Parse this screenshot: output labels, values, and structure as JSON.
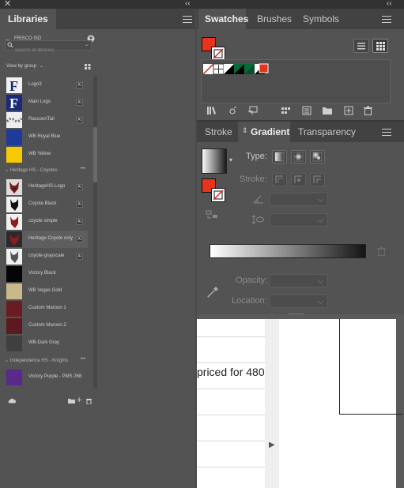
{
  "libraries": {
    "tab_label": "Libraries",
    "library_name": "FRISCO ISD",
    "search_placeholder": "Search all libraries",
    "view_by": "View by group",
    "items_top": [
      {
        "label": "Logo3",
        "badge": "Ai",
        "icon": "f-logo-icon"
      },
      {
        "label": "Main Logo",
        "badge": "Ai",
        "icon": "f-logo-icon"
      },
      {
        "label": "RaccoonTail",
        "badge": "Ai",
        "icon": "raccoon-tail-icon"
      },
      {
        "label": "WB Royal Blue",
        "color": "#1e3a9a"
      },
      {
        "label": "WB Yellow",
        "color": "#f7c900"
      }
    ],
    "group_heritage": "Heritage HS - Coyotes",
    "items_heritage": [
      {
        "label": "HeritageHS-Logo",
        "badge": "Ai",
        "icon": "coyote-logo-icon"
      },
      {
        "label": "Coyote Black",
        "badge": "Ai",
        "icon": "coyote-black-icon"
      },
      {
        "label": "coyote simple",
        "badge": "Ai",
        "icon": "coyote-simple-icon"
      },
      {
        "label": "Heritage Coyote only",
        "badge": "Ai",
        "icon": "coyote-only-icon"
      },
      {
        "label": "coyote-grayscale",
        "badge": "Ai",
        "icon": "coyote-grayscale-icon"
      },
      {
        "label": "Victory Black",
        "color": "#050505"
      },
      {
        "label": "WB Vegas Gold",
        "color": "#c9b88a"
      },
      {
        "label": "Custom Maroon 1",
        "color": "#6b1b22"
      },
      {
        "label": "Custom Maroon 2",
        "color": "#5c1a20"
      },
      {
        "label": "WB-Dark Gray",
        "color": "#3f3f3f"
      }
    ],
    "group_independence": "Independence HS - Knights",
    "items_independence": [
      {
        "label": "Victory Purple - PMS 268",
        "color": "#5a2a8a"
      }
    ]
  },
  "swatches": {
    "tabs": [
      "Swatches",
      "Brushes",
      "Symbols"
    ],
    "fill_color": "#e8341c"
  },
  "gradient": {
    "tabs": [
      "Stroke",
      "Gradient",
      "Transparency"
    ],
    "type_label": "Type:",
    "stroke_label": "Stroke:",
    "opacity_label": "Opacity:",
    "location_label": "Location:"
  },
  "document": {
    "text_fragment": "priced for 480"
  }
}
